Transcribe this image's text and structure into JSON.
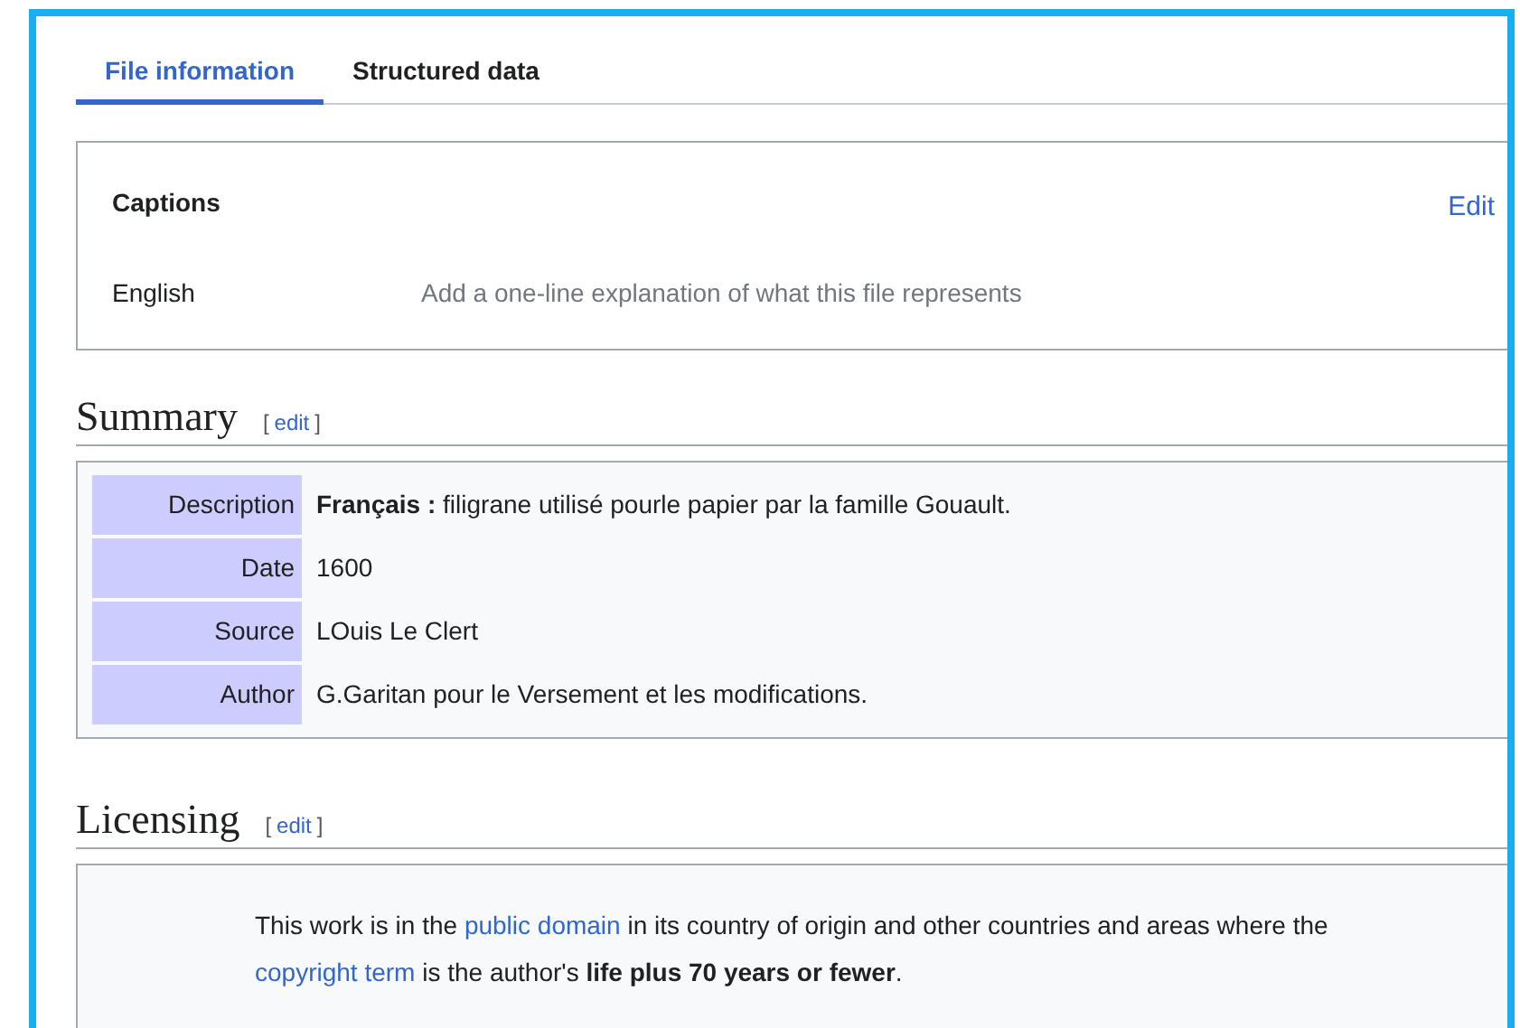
{
  "tabs": [
    {
      "label": "File information",
      "selected": true
    },
    {
      "label": "Structured data",
      "selected": false
    }
  ],
  "captions": {
    "title": "Captions",
    "edit": "Edit",
    "rows": [
      {
        "language": "English",
        "placeholder": "Add a one-line explanation of what this file represents"
      }
    ]
  },
  "summary": {
    "heading": "Summary",
    "edit_open": "[",
    "edit": "edit",
    "edit_close": "]",
    "rows": [
      {
        "label": "Description",
        "value": "**Français :** filigrane utilisé pourle papier par la famille Gouault."
      },
      {
        "label": "Date",
        "value": "1600"
      },
      {
        "label": "Source",
        "value": "LOuis Le Clert"
      },
      {
        "label": "Author",
        "value": "G.Garitan pour le Versement et les modifications."
      }
    ]
  },
  "licensing": {
    "heading": "Licensing",
    "edit_open": "[",
    "edit": "edit",
    "edit_close": "]",
    "segments": [
      {
        "kind": "text",
        "text": "This work is in the "
      },
      {
        "kind": "link",
        "text": "public domain"
      },
      {
        "kind": "text",
        "text": " in its country of origin and other countries and areas where the "
      },
      {
        "kind": "link",
        "text": "copyright term"
      },
      {
        "kind": "text",
        "text": " is the author's **life plus 70 years or fewer**."
      }
    ]
  }
}
